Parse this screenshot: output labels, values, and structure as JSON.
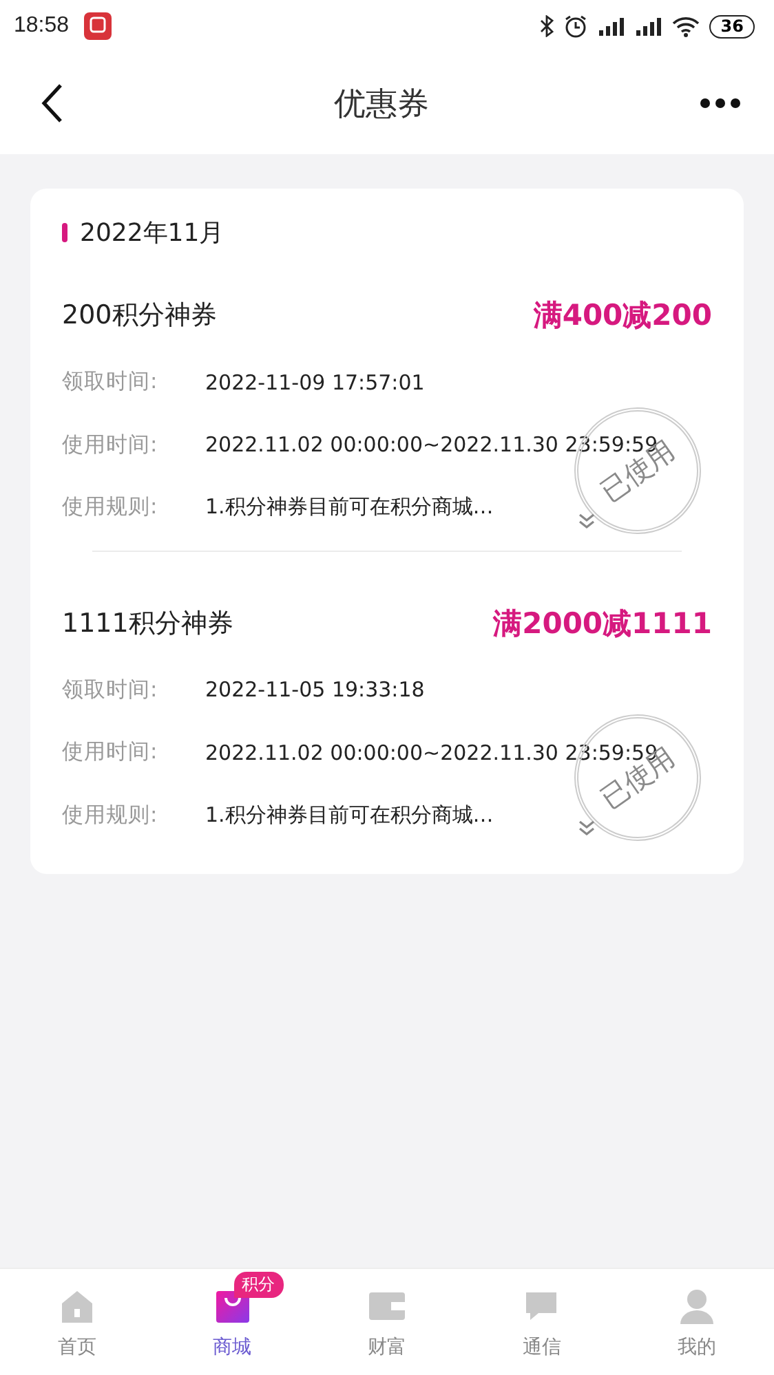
{
  "status_bar": {
    "time": "18:58",
    "battery": "36"
  },
  "header": {
    "title": "优惠券"
  },
  "month": "2022年11月",
  "coupons": [
    {
      "name": "200积分神券",
      "offer": "满400减200",
      "rows": [
        {
          "label": "领取时间:",
          "value": "2022-11-09 17:57:01"
        },
        {
          "label": "使用时间:",
          "value": "2022.11.02 00:00:00~2022.11.30 23:59:59"
        },
        {
          "label": "使用规则:",
          "value": "1.积分神券目前可在积分商城…"
        }
      ],
      "stamp": "已使用",
      "expanded": false
    },
    {
      "name": "1111积分神券",
      "offer": "满2000减1111",
      "rows": [
        {
          "label": "领取时间:",
          "value": "2022-11-05 19:33:18"
        },
        {
          "label": "使用时间:",
          "value": "2022.11.02 00:00:00~2022.11.30 23:59:59"
        },
        {
          "label": "使用规则:",
          "value": "1.积分神券目前可在积分商城…"
        }
      ],
      "stamp": "已使用",
      "expanded": false
    }
  ],
  "nav": [
    {
      "kind": "home",
      "label": "首页",
      "selected": false
    },
    {
      "kind": "mall",
      "label": "商城",
      "selected": true,
      "badge": "积分"
    },
    {
      "kind": "wallet",
      "label": "财富",
      "selected": false
    },
    {
      "kind": "chat",
      "label": "通信",
      "selected": false
    },
    {
      "kind": "profile",
      "label": "我的",
      "selected": false
    }
  ]
}
